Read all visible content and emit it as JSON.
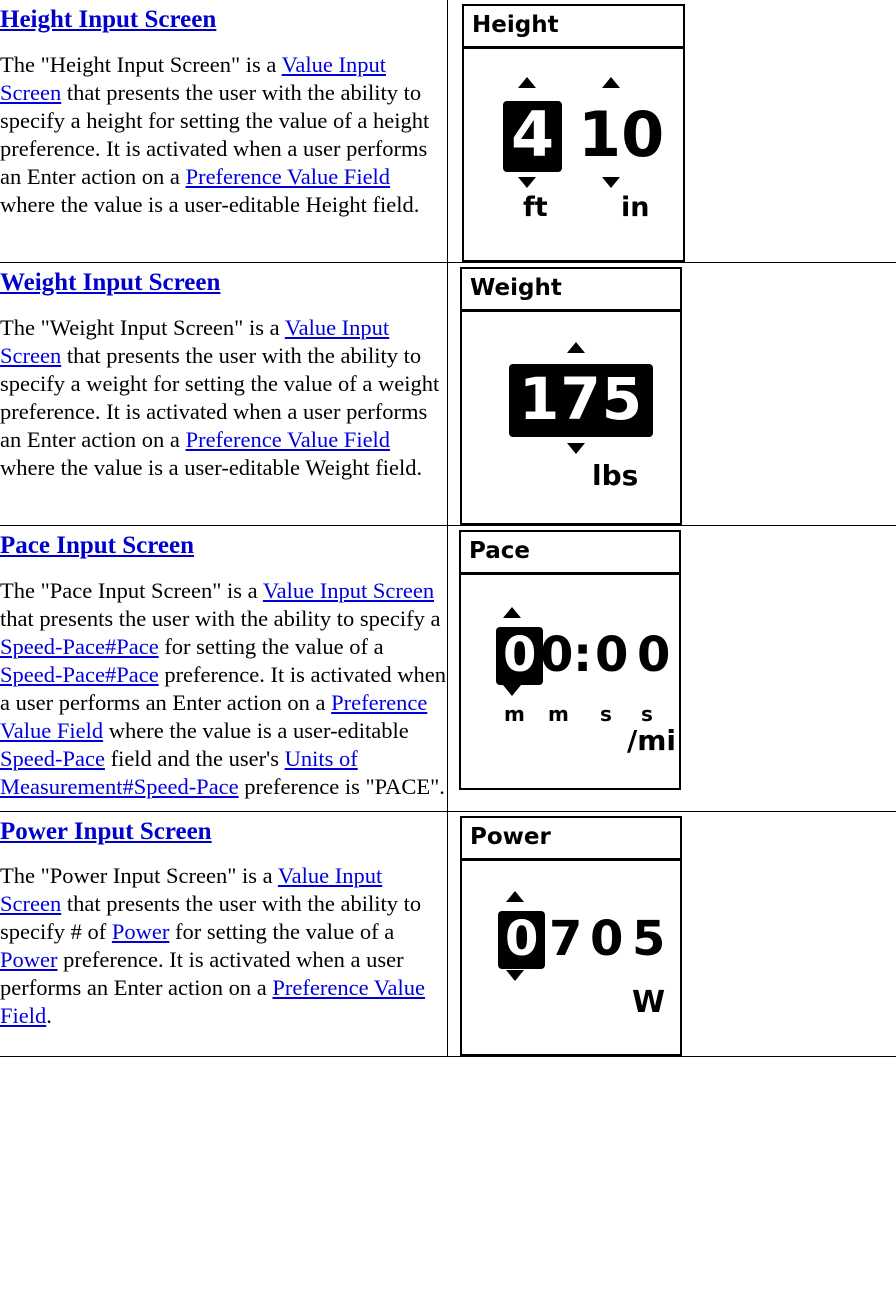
{
  "sections": [
    {
      "id": "height",
      "title": "Height Input Screen",
      "text_runs": [
        {
          "t": "The \"Height Input Screen\" is a ",
          "link": false
        },
        {
          "t": "Value Input Screen",
          "link": true
        },
        {
          "t": " that presents the user with the ability to specify a height for setting the value of a height preference. It is activated when a user performs an Enter action on a ",
          "link": false
        },
        {
          "t": "Preference Value Field",
          "link": true
        },
        {
          "t": " where the value is a user-editable Height field.",
          "link": false
        }
      ],
      "device": {
        "title": "Height",
        "fields": [
          {
            "value": "4",
            "selected": true,
            "unit": "ft"
          },
          {
            "value": "10",
            "selected": false,
            "unit": "in"
          }
        ]
      }
    },
    {
      "id": "weight",
      "title": "Weight Input Screen",
      "text_runs": [
        {
          "t": "The \"Weight Input Screen\" is a ",
          "link": false
        },
        {
          "t": "Value Input Screen",
          "link": true
        },
        {
          "t": " that presents the user with the ability to specify a weight for setting the value of a weight preference. It is activated when a user performs an Enter action on a ",
          "link": false
        },
        {
          "t": "Preference Value Field",
          "link": true
        },
        {
          "t": " where the value is a user-editable Weight field.",
          "link": false
        }
      ],
      "device": {
        "title": "Weight",
        "fields": [
          {
            "value": "175",
            "selected": true,
            "unit": "lbs"
          }
        ]
      }
    },
    {
      "id": "pace",
      "title": "Pace Input Screen",
      "text_runs": [
        {
          "t": "The \"Pace Input Screen\" is a ",
          "link": false
        },
        {
          "t": "Value Input Screen",
          "link": true
        },
        {
          "t": " that presents the user with the ability to specify a ",
          "link": false
        },
        {
          "t": "Speed-Pace#Pace",
          "link": true
        },
        {
          "t": " for setting the value of a ",
          "link": false
        },
        {
          "t": "Speed-Pace#Pace",
          "link": true
        },
        {
          "t": " preference. It is activated when a user performs an Enter action on a ",
          "link": false
        },
        {
          "t": "Preference Value Field",
          "link": true
        },
        {
          "t": " where the value is a user-editable ",
          "link": false
        },
        {
          "t": "Speed-Pace",
          "link": true
        },
        {
          "t": " field and the user's ",
          "link": false
        },
        {
          "t": "Units of Measurement#Speed-Pace",
          "link": true
        },
        {
          "t": " preference is \"PACE\".",
          "link": false
        }
      ],
      "device": {
        "title": "Pace",
        "digits": [
          "0",
          "0",
          ":",
          "0",
          "0"
        ],
        "digit_labels": [
          "m",
          "m",
          "s",
          "s"
        ],
        "unit": "/mi"
      }
    },
    {
      "id": "power",
      "title": "Power Input Screen",
      "text_runs": [
        {
          "t": "The \"Power Input Screen\" is a ",
          "link": false
        },
        {
          "t": "Value Input Screen",
          "link": true
        },
        {
          "t": " that presents the user with the ability to specify # of ",
          "link": false
        },
        {
          "t": "Power",
          "link": true
        },
        {
          "t": " for setting the value of a ",
          "link": false
        },
        {
          "t": "Power",
          "link": true
        },
        {
          "t": " preference. It is activated when a user performs an Enter action on a ",
          "link": false
        },
        {
          "t": "Preference Value Field",
          "link": true
        },
        {
          "t": ".",
          "link": false
        }
      ],
      "device": {
        "title": "Power",
        "digits": [
          "0",
          "7",
          "0",
          "5"
        ],
        "unit": "W"
      }
    }
  ],
  "colors": {
    "link": "#0000dd",
    "heading_link": "#0000cc",
    "lcd_foreground": "#000000",
    "lcd_background": "#ffffff"
  }
}
